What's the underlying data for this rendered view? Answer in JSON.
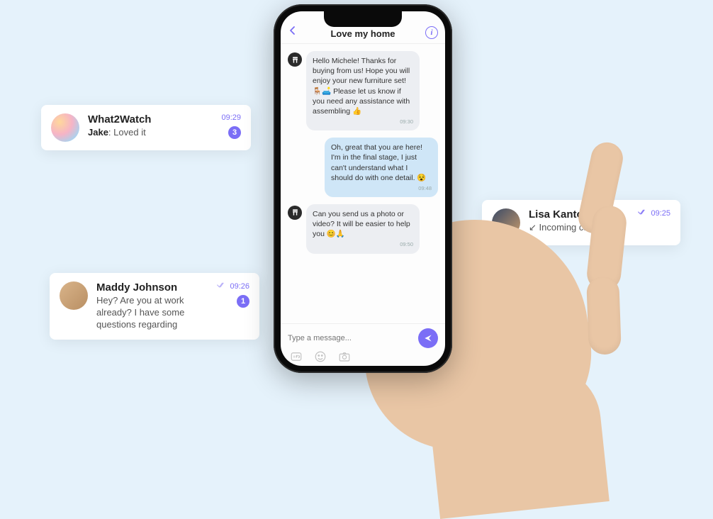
{
  "cards": {
    "what2watch": {
      "title": "What2Watch",
      "sender": "Jake",
      "preview": "Loved it",
      "time": "09:29",
      "badge": "3"
    },
    "maddy": {
      "title": "Maddy Johnson",
      "preview": "Hey? Are you at work already? I have some questions regarding",
      "time": "09:26",
      "badge": "1"
    },
    "lisa": {
      "title": "Lisa Kantor",
      "status": "Incoming call",
      "time": "09:25"
    }
  },
  "chat": {
    "header_title": "Love my home",
    "info_label": "i",
    "messages": [
      {
        "dir": "in",
        "text": "Hello Michele! Thanks for buying from us! Hope you will enjoy your new furniture set! 🪑🛋️ Please let us know if you need any assistance with assembling 👍",
        "time": "09:30"
      },
      {
        "dir": "out",
        "text": "Oh, great that you are here! I'm in the final stage, I just can't understand what I should do with one detail. 😵",
        "time": "09:48"
      },
      {
        "dir": "in",
        "text": "Can you send us a photo or video? It will be easier to help you 😊🙏",
        "time": "09:50"
      }
    ],
    "composer_placeholder": "Type a message..."
  }
}
